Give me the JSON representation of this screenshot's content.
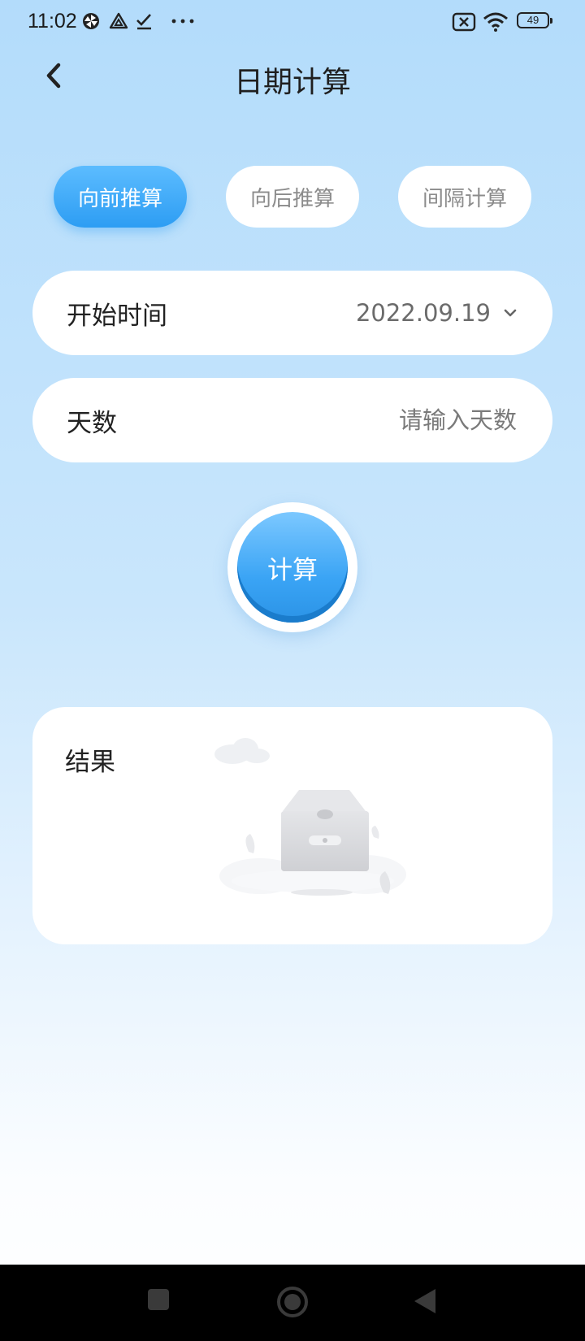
{
  "status_bar": {
    "time": "11:02",
    "battery": "49",
    "icons": [
      "pinwheel-icon",
      "triangle-app-icon",
      "checkmark-icon",
      "more-dots-icon",
      "no-sim-icon",
      "wifi-icon",
      "battery-icon"
    ]
  },
  "header": {
    "title": "日期计算",
    "back_icon": "chevron-left-icon"
  },
  "tabs": [
    {
      "label": "向前推算",
      "active": true
    },
    {
      "label": "向后推算",
      "active": false
    },
    {
      "label": "间隔计算",
      "active": false
    }
  ],
  "form": {
    "start_label": "开始时间",
    "start_value": "2022.09.19",
    "days_label": "天数",
    "days_placeholder": "请输入天数"
  },
  "calc_button": {
    "label": "计算"
  },
  "result": {
    "title": "结果",
    "illustration": "empty-box-illustration"
  },
  "nav_bar": {
    "icons": [
      "recent-apps-icon",
      "home-icon",
      "back-icon"
    ]
  },
  "colors": {
    "accent": "#3aa4f5",
    "background_top": "#b3dcfb",
    "background_bottom": "#ffffff"
  }
}
